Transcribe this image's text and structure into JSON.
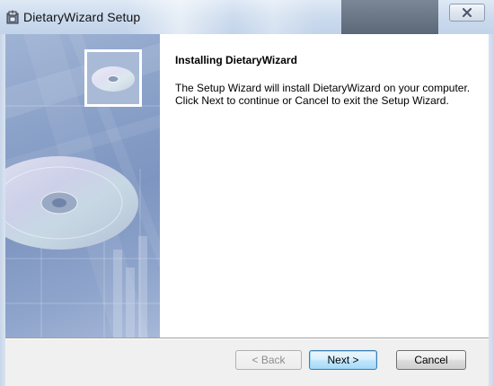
{
  "window": {
    "title": "DietaryWizard Setup"
  },
  "content": {
    "heading": "Installing DietaryWizard",
    "body": "The Setup Wizard will install DietaryWizard on your computer.  Click Next to continue or Cancel to exit the Setup Wizard."
  },
  "buttons": {
    "back": "< Back",
    "next": "Next >",
    "cancel": "Cancel"
  },
  "icons": {
    "app": "installer-icon",
    "close": "close-icon",
    "disc": "cd-disc-icon"
  },
  "colors": {
    "side_art": "#8aa1c8",
    "default_button_border": "#3c7fb1"
  }
}
